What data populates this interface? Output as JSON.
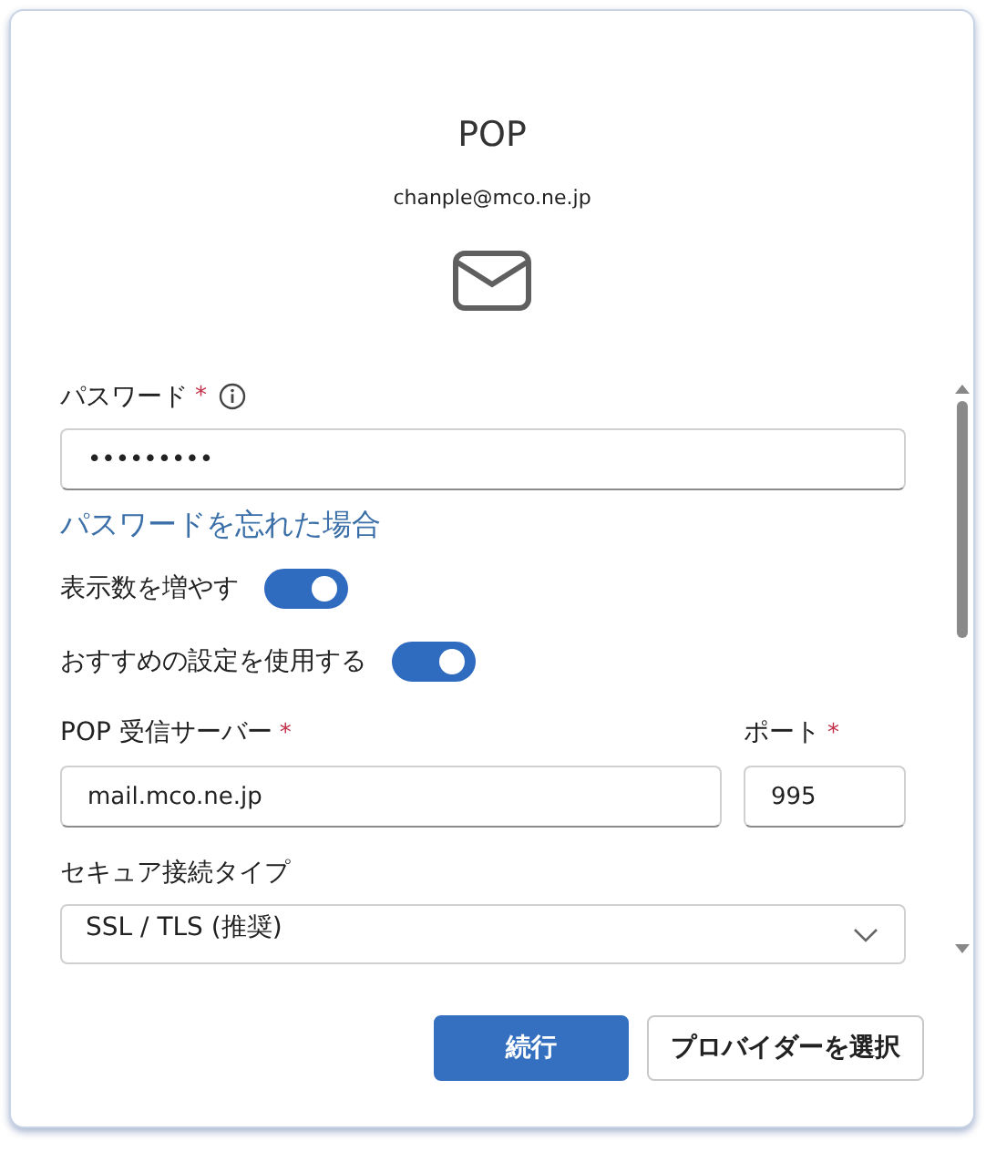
{
  "header": {
    "title": "POP",
    "email": "chanple@mco.ne.jp"
  },
  "password": {
    "label": "パスワード",
    "required_mark": "*",
    "value": "•••••••••"
  },
  "forgot_link": "パスワードを忘れた場合",
  "toggles": [
    {
      "label": "表示数を増やす",
      "on": true
    },
    {
      "label": "おすすめの設定を使用する",
      "on": true
    }
  ],
  "server": {
    "label": "POP 受信サーバー",
    "required_mark": "*",
    "value": "mail.mco.ne.jp"
  },
  "port": {
    "label": "ポート",
    "required_mark": "*",
    "value": "995"
  },
  "security": {
    "label": "セキュア接続タイプ",
    "value": "SSL / TLS (推奨)"
  },
  "buttons": [
    {
      "label": "続行",
      "kind": "primary"
    },
    {
      "label": "プロバイダーを選択",
      "kind": "secondary"
    }
  ]
}
